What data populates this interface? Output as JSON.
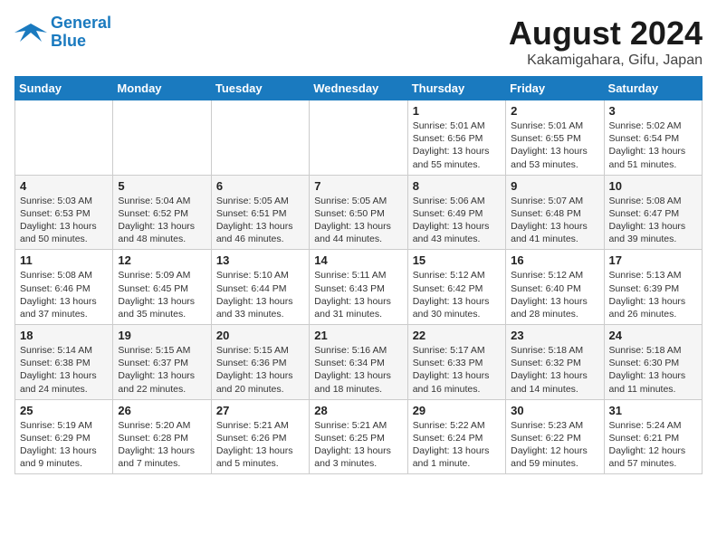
{
  "logo": {
    "line1": "General",
    "line2": "Blue"
  },
  "title": "August 2024",
  "subtitle": "Kakamigahara, Gifu, Japan",
  "weekdays": [
    "Sunday",
    "Monday",
    "Tuesday",
    "Wednesday",
    "Thursday",
    "Friday",
    "Saturday"
  ],
  "weeks": [
    [
      {
        "day": "",
        "info": ""
      },
      {
        "day": "",
        "info": ""
      },
      {
        "day": "",
        "info": ""
      },
      {
        "day": "",
        "info": ""
      },
      {
        "day": "1",
        "info": "Sunrise: 5:01 AM\nSunset: 6:56 PM\nDaylight: 13 hours\nand 55 minutes."
      },
      {
        "day": "2",
        "info": "Sunrise: 5:01 AM\nSunset: 6:55 PM\nDaylight: 13 hours\nand 53 minutes."
      },
      {
        "day": "3",
        "info": "Sunrise: 5:02 AM\nSunset: 6:54 PM\nDaylight: 13 hours\nand 51 minutes."
      }
    ],
    [
      {
        "day": "4",
        "info": "Sunrise: 5:03 AM\nSunset: 6:53 PM\nDaylight: 13 hours\nand 50 minutes."
      },
      {
        "day": "5",
        "info": "Sunrise: 5:04 AM\nSunset: 6:52 PM\nDaylight: 13 hours\nand 48 minutes."
      },
      {
        "day": "6",
        "info": "Sunrise: 5:05 AM\nSunset: 6:51 PM\nDaylight: 13 hours\nand 46 minutes."
      },
      {
        "day": "7",
        "info": "Sunrise: 5:05 AM\nSunset: 6:50 PM\nDaylight: 13 hours\nand 44 minutes."
      },
      {
        "day": "8",
        "info": "Sunrise: 5:06 AM\nSunset: 6:49 PM\nDaylight: 13 hours\nand 43 minutes."
      },
      {
        "day": "9",
        "info": "Sunrise: 5:07 AM\nSunset: 6:48 PM\nDaylight: 13 hours\nand 41 minutes."
      },
      {
        "day": "10",
        "info": "Sunrise: 5:08 AM\nSunset: 6:47 PM\nDaylight: 13 hours\nand 39 minutes."
      }
    ],
    [
      {
        "day": "11",
        "info": "Sunrise: 5:08 AM\nSunset: 6:46 PM\nDaylight: 13 hours\nand 37 minutes."
      },
      {
        "day": "12",
        "info": "Sunrise: 5:09 AM\nSunset: 6:45 PM\nDaylight: 13 hours\nand 35 minutes."
      },
      {
        "day": "13",
        "info": "Sunrise: 5:10 AM\nSunset: 6:44 PM\nDaylight: 13 hours\nand 33 minutes."
      },
      {
        "day": "14",
        "info": "Sunrise: 5:11 AM\nSunset: 6:43 PM\nDaylight: 13 hours\nand 31 minutes."
      },
      {
        "day": "15",
        "info": "Sunrise: 5:12 AM\nSunset: 6:42 PM\nDaylight: 13 hours\nand 30 minutes."
      },
      {
        "day": "16",
        "info": "Sunrise: 5:12 AM\nSunset: 6:40 PM\nDaylight: 13 hours\nand 28 minutes."
      },
      {
        "day": "17",
        "info": "Sunrise: 5:13 AM\nSunset: 6:39 PM\nDaylight: 13 hours\nand 26 minutes."
      }
    ],
    [
      {
        "day": "18",
        "info": "Sunrise: 5:14 AM\nSunset: 6:38 PM\nDaylight: 13 hours\nand 24 minutes."
      },
      {
        "day": "19",
        "info": "Sunrise: 5:15 AM\nSunset: 6:37 PM\nDaylight: 13 hours\nand 22 minutes."
      },
      {
        "day": "20",
        "info": "Sunrise: 5:15 AM\nSunset: 6:36 PM\nDaylight: 13 hours\nand 20 minutes."
      },
      {
        "day": "21",
        "info": "Sunrise: 5:16 AM\nSunset: 6:34 PM\nDaylight: 13 hours\nand 18 minutes."
      },
      {
        "day": "22",
        "info": "Sunrise: 5:17 AM\nSunset: 6:33 PM\nDaylight: 13 hours\nand 16 minutes."
      },
      {
        "day": "23",
        "info": "Sunrise: 5:18 AM\nSunset: 6:32 PM\nDaylight: 13 hours\nand 14 minutes."
      },
      {
        "day": "24",
        "info": "Sunrise: 5:18 AM\nSunset: 6:30 PM\nDaylight: 13 hours\nand 11 minutes."
      }
    ],
    [
      {
        "day": "25",
        "info": "Sunrise: 5:19 AM\nSunset: 6:29 PM\nDaylight: 13 hours\nand 9 minutes."
      },
      {
        "day": "26",
        "info": "Sunrise: 5:20 AM\nSunset: 6:28 PM\nDaylight: 13 hours\nand 7 minutes."
      },
      {
        "day": "27",
        "info": "Sunrise: 5:21 AM\nSunset: 6:26 PM\nDaylight: 13 hours\nand 5 minutes."
      },
      {
        "day": "28",
        "info": "Sunrise: 5:21 AM\nSunset: 6:25 PM\nDaylight: 13 hours\nand 3 minutes."
      },
      {
        "day": "29",
        "info": "Sunrise: 5:22 AM\nSunset: 6:24 PM\nDaylight: 13 hours\nand 1 minute."
      },
      {
        "day": "30",
        "info": "Sunrise: 5:23 AM\nSunset: 6:22 PM\nDaylight: 12 hours\nand 59 minutes."
      },
      {
        "day": "31",
        "info": "Sunrise: 5:24 AM\nSunset: 6:21 PM\nDaylight: 12 hours\nand 57 minutes."
      }
    ]
  ]
}
